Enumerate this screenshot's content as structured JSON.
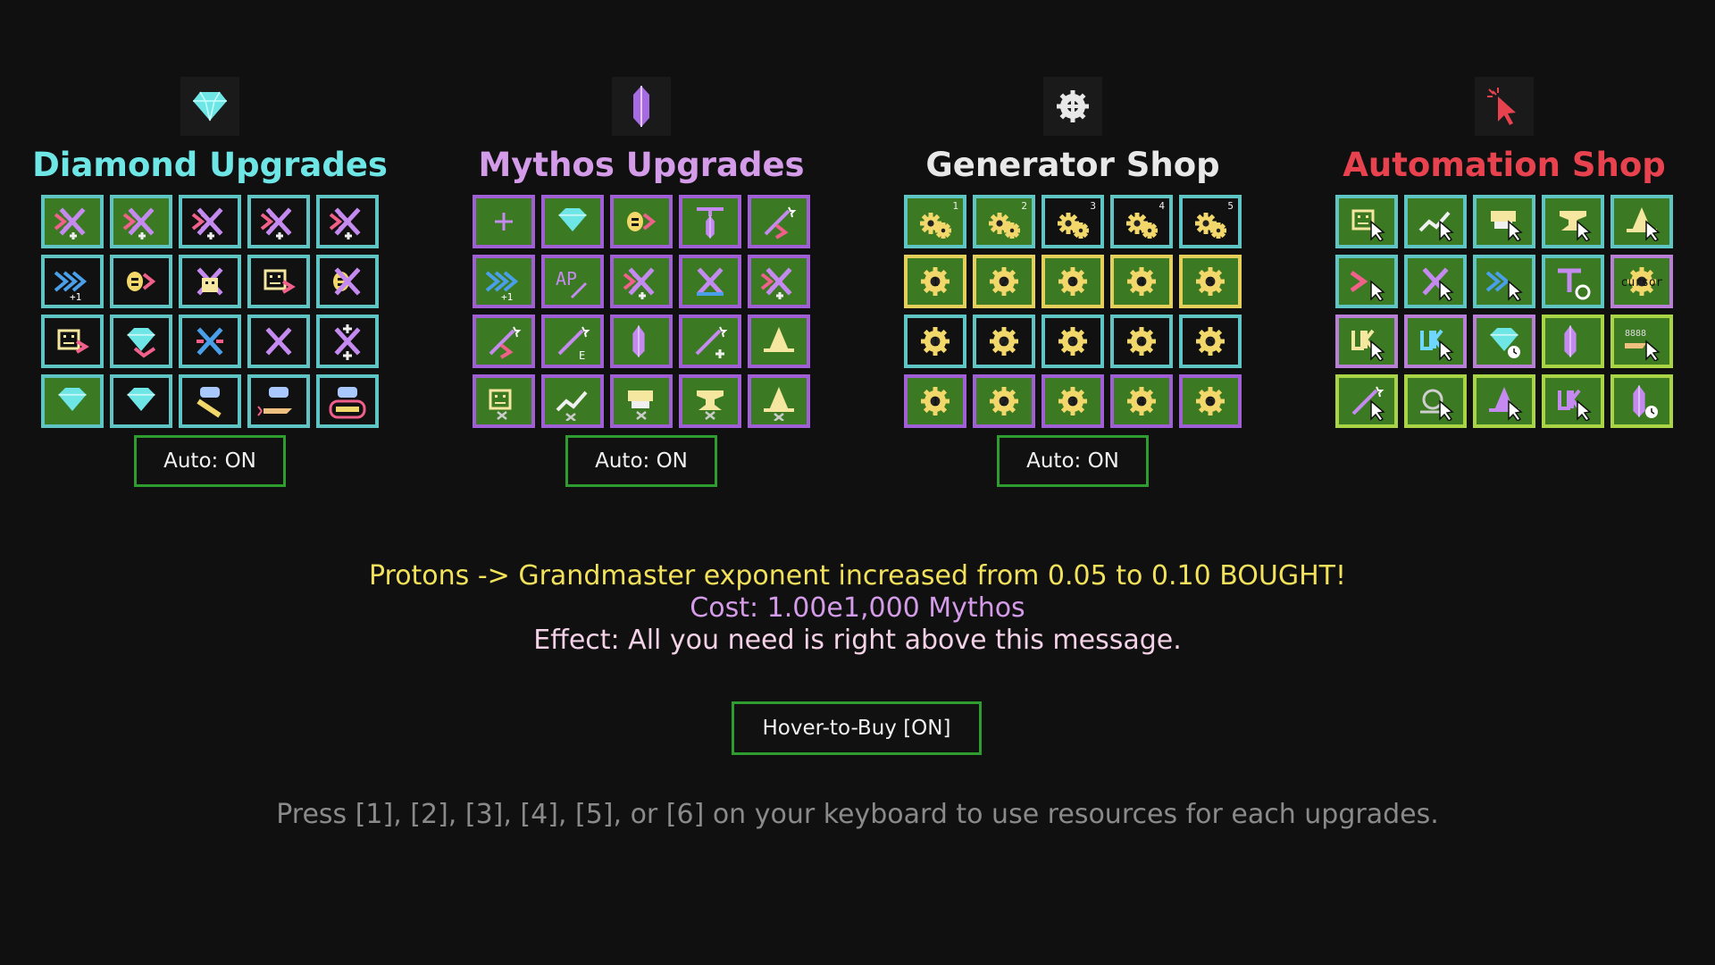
{
  "sections": [
    {
      "title": "Diamond Upgrades",
      "title_color": "#6fe6e6",
      "icon": "diamond-icon",
      "auto_label": "Auto: ON",
      "tiles": [
        {
          "icon": "arrow-cross-plus-icon",
          "bg": "green",
          "border": "teal"
        },
        {
          "icon": "arrow-cross-double-plus-icon",
          "bg": "green",
          "border": "teal"
        },
        {
          "icon": "arrow-cross-triple-plus-icon",
          "bg": "black",
          "border": "teal"
        },
        {
          "icon": "arrow-cross-plus-grid-icon",
          "bg": "black",
          "border": "teal"
        },
        {
          "icon": "arrow-cross-plus-grid-icon",
          "bg": "black",
          "border": "teal"
        },
        {
          "icon": "blue-arrows-plus-one-icon",
          "bg": "black",
          "border": "teal"
        },
        {
          "icon": "coin-arrow-icon",
          "bg": "black",
          "border": "teal"
        },
        {
          "icon": "robot-cross-icon",
          "bg": "black",
          "border": "teal"
        },
        {
          "icon": "face-arrow-icon",
          "bg": "black",
          "border": "teal"
        },
        {
          "icon": "coin-cross-icon",
          "bg": "black",
          "border": "teal"
        },
        {
          "icon": "face-arrow-blue-icon",
          "bg": "black",
          "border": "teal"
        },
        {
          "icon": "diamond-arrow-icon",
          "bg": "black",
          "border": "teal"
        },
        {
          "icon": "blue-cross-icon",
          "bg": "black",
          "border": "teal"
        },
        {
          "icon": "purple-cross-icon",
          "bg": "black",
          "border": "teal"
        },
        {
          "icon": "cross-plus-icon",
          "bg": "black",
          "border": "teal"
        },
        {
          "icon": "layered-diamond-icon",
          "bg": "green",
          "border": "teal"
        },
        {
          "icon": "diamond-wand-icon",
          "bg": "black",
          "border": "teal"
        },
        {
          "icon": "discord-scroll-icon",
          "bg": "black",
          "border": "teal"
        },
        {
          "icon": "discord-rocket-icon",
          "bg": "black",
          "border": "teal"
        },
        {
          "icon": "discord-cart-icon",
          "bg": "black",
          "border": "teal"
        }
      ]
    },
    {
      "title": "Mythos Upgrades",
      "title_color": "#d49be8",
      "icon": "crystal-icon",
      "auto_label": "Auto: ON",
      "tiles": [
        {
          "icon": "plus-icon",
          "bg": "green",
          "border": "purple"
        },
        {
          "icon": "diamond-wand-icon",
          "bg": "green",
          "border": "purple"
        },
        {
          "icon": "coin-t-icon",
          "bg": "green",
          "border": "purple"
        },
        {
          "icon": "crystal-t-icon",
          "bg": "green",
          "border": "purple"
        },
        {
          "icon": "arrow-wand-icon",
          "bg": "green",
          "border": "purple"
        },
        {
          "icon": "blue-arrows-p-icon",
          "bg": "green",
          "border": "purple"
        },
        {
          "icon": "ap-wand-icon",
          "bg": "green",
          "border": "purple"
        },
        {
          "icon": "coin-arrow-cross-icon",
          "bg": "green",
          "border": "purple"
        },
        {
          "icon": "cross-bar-icon",
          "bg": "green",
          "border": "purple"
        },
        {
          "icon": "c-arrow-cross-icon",
          "bg": "green",
          "border": "purple"
        },
        {
          "icon": "wand-arrow-icon",
          "bg": "green",
          "border": "purple"
        },
        {
          "icon": "wand-e-icon",
          "bg": "green",
          "border": "purple"
        },
        {
          "icon": "crystal-outline-plus-icon",
          "bg": "green",
          "border": "purple"
        },
        {
          "icon": "wand-plus-icon",
          "bg": "green",
          "border": "purple"
        },
        {
          "icon": "wizard-hat-icon",
          "bg": "green",
          "border": "purple"
        },
        {
          "icon": "face-cross-icon",
          "bg": "green",
          "border": "purple"
        },
        {
          "icon": "chart-up-cross-icon",
          "bg": "green",
          "border": "purple"
        },
        {
          "icon": "printer-cross-icon",
          "bg": "green",
          "border": "purple"
        },
        {
          "icon": "anvil-cross-icon",
          "bg": "green",
          "border": "purple"
        },
        {
          "icon": "hat-cross-icon",
          "bg": "green",
          "border": "purple"
        }
      ]
    },
    {
      "title": "Generator Shop",
      "title_color": "#e8e8e8",
      "icon": "gear-plus-icon",
      "auto_label": "Auto: ON",
      "tiles": [
        {
          "icon": "gears-icon",
          "num": "1",
          "bg": "green",
          "border": "teal"
        },
        {
          "icon": "gears-icon",
          "num": "2",
          "bg": "green",
          "border": "teal"
        },
        {
          "icon": "gears-icon",
          "num": "3",
          "bg": "black",
          "border": "teal"
        },
        {
          "icon": "gears-icon",
          "num": "4",
          "bg": "black",
          "border": "teal"
        },
        {
          "icon": "gears-icon",
          "num": "5",
          "bg": "black",
          "border": "teal"
        },
        {
          "icon": "gear-1-icon",
          "num": "",
          "bg": "green",
          "border": "yellow"
        },
        {
          "icon": "gear-2-icon",
          "num": "",
          "bg": "green",
          "border": "yellow"
        },
        {
          "icon": "gear-3-icon",
          "num": "",
          "bg": "green",
          "border": "yellow"
        },
        {
          "icon": "gear-4-icon",
          "num": "",
          "bg": "green",
          "border": "yellow"
        },
        {
          "icon": "gear-5-icon",
          "num": "",
          "bg": "green",
          "border": "yellow"
        },
        {
          "icon": "gear-1-icon",
          "num": "",
          "bg": "black",
          "border": "teal"
        },
        {
          "icon": "gear-2-icon",
          "num": "",
          "bg": "black",
          "border": "teal"
        },
        {
          "icon": "gear-3-icon",
          "num": "",
          "bg": "black",
          "border": "teal"
        },
        {
          "icon": "gear-4-icon",
          "num": "",
          "bg": "black",
          "border": "teal"
        },
        {
          "icon": "gear-5-icon",
          "num": "",
          "bg": "black",
          "border": "teal"
        },
        {
          "icon": "gear-1-icon",
          "num": "",
          "bg": "green",
          "border": "purple"
        },
        {
          "icon": "gear-2-icon",
          "num": "",
          "bg": "green",
          "border": "purple"
        },
        {
          "icon": "gear-3-icon",
          "num": "",
          "bg": "green",
          "border": "purple"
        },
        {
          "icon": "gear-4-icon",
          "num": "",
          "bg": "green",
          "border": "purple"
        },
        {
          "icon": "gear-5-icon",
          "num": "",
          "bg": "green",
          "border": "purple"
        }
      ]
    },
    {
      "title": "Automation Shop",
      "title_color": "#e8424f",
      "icon": "cursor-click-icon",
      "auto_label": "",
      "tiles": [
        {
          "icon": "face-cursor-icon",
          "bg": "green",
          "border": "teal"
        },
        {
          "icon": "chart-cursor-icon",
          "bg": "green",
          "border": "teal"
        },
        {
          "icon": "printer-cursor-icon",
          "bg": "green",
          "border": "teal"
        },
        {
          "icon": "anvil-cursor-icon",
          "bg": "green",
          "border": "teal"
        },
        {
          "icon": "hat-cursor-icon",
          "bg": "green",
          "border": "teal"
        },
        {
          "icon": "arrow-cursor-icon",
          "bg": "green",
          "border": "teal"
        },
        {
          "icon": "cross-cursor-icon",
          "bg": "green",
          "border": "teal"
        },
        {
          "icon": "blue-arrow-cursor-icon",
          "bg": "green",
          "border": "teal"
        },
        {
          "icon": "t-refresh-icon",
          "bg": "green",
          "border": "teal"
        },
        {
          "icon": "gear-cursor-icon",
          "bg": "green",
          "border": "pink"
        },
        {
          "icon": "uk-cursor-icon",
          "bg": "green",
          "border": "pink"
        },
        {
          "icon": "uk-cursor-blue-icon",
          "bg": "green",
          "border": "pink"
        },
        {
          "icon": "diamond-clock-icon",
          "bg": "green",
          "border": "pink"
        },
        {
          "icon": "crystal-cursor-icon",
          "bg": "green",
          "border": "lime"
        },
        {
          "icon": "rocket-cursor-icon",
          "bg": "green",
          "border": "lime"
        },
        {
          "icon": "wand-cursor-icon",
          "bg": "green",
          "border": "lime"
        },
        {
          "icon": "loop-cursor-icon",
          "bg": "green",
          "border": "lime"
        },
        {
          "icon": "hat-cursor-purple-icon",
          "bg": "green",
          "border": "lime"
        },
        {
          "icon": "uk-cursor-purple-icon",
          "bg": "green",
          "border": "lime"
        },
        {
          "icon": "crystal-clock-icon",
          "bg": "green",
          "border": "lime"
        }
      ]
    }
  ],
  "message": {
    "line1": "Protons -> Grandmaster exponent increased from 0.05 to 0.10 BOUGHT!",
    "line1_color": "#f2e15a",
    "line2": "Cost: 1.00e1,000 Mythos",
    "line2_color": "#d49be8",
    "line3": "Effect: All you need is right above this message.",
    "line3_color": "#f3d1e6"
  },
  "hover_button": "Hover-to-Buy [ON]",
  "hint": "Press [1], [2], [3], [4], [5], or [6] on your keyboard to use resources for each upgrades."
}
